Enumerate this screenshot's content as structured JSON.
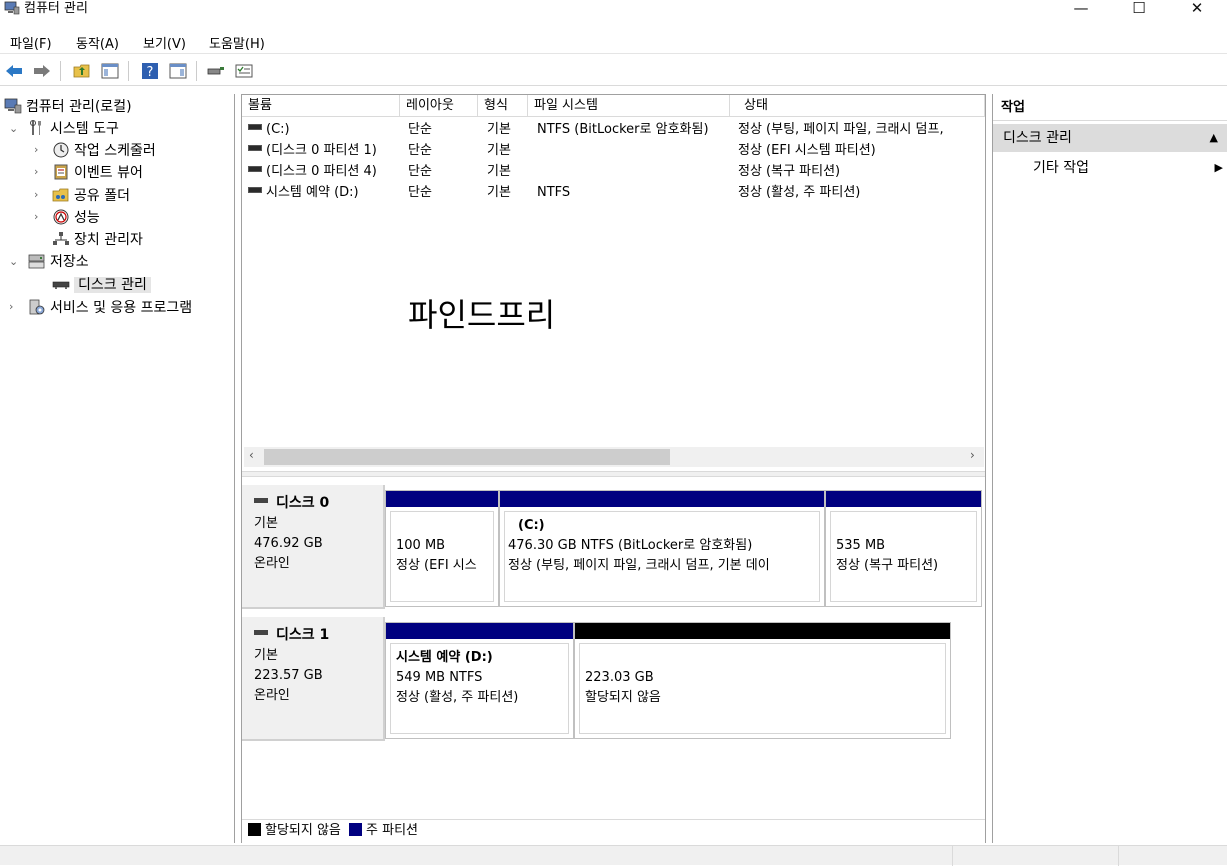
{
  "window": {
    "title": "컴퓨터 관리",
    "minimize": "—",
    "maximize": "☐",
    "close": "✕"
  },
  "menu": [
    "파일(F)",
    "동작(A)",
    "보기(V)",
    "도움말(H)"
  ],
  "tree": {
    "root": "컴퓨터 관리(로컬)",
    "system_tools": "시스템 도구",
    "task_scheduler": "작업 스케줄러",
    "event_viewer": "이벤트 뷰어",
    "shared_folders": "공유 폴더",
    "performance": "성능",
    "device_manager": "장치 관리자",
    "storage": "저장소",
    "disk_management": "디스크 관리",
    "services": "서비스 및 응용 프로그램"
  },
  "volume_list": {
    "columns": [
      "볼륨",
      "레이아웃",
      "형식",
      "파일 시스템",
      "상태"
    ],
    "rows": [
      {
        "volume": "(C:)",
        "layout": "단순",
        "type": "기본",
        "fs": "NTFS (BitLocker로 암호화됨)",
        "status": "정상 (부팅, 페이지 파일, 크래시 덤프,"
      },
      {
        "volume": "(디스크 0 파티션 1)",
        "layout": "단순",
        "type": "기본",
        "fs": "",
        "status": "정상 (EFI 시스템 파티션)"
      },
      {
        "volume": "(디스크 0 파티션 4)",
        "layout": "단순",
        "type": "기본",
        "fs": "",
        "status": "정상 (복구 파티션)"
      },
      {
        "volume": "시스템 예약 (D:)",
        "layout": "단순",
        "type": "기본",
        "fs": "NTFS",
        "status": "정상 (활성, 주 파티션)"
      }
    ]
  },
  "watermark": "파인드프리",
  "disks": [
    {
      "name": "디스크 0",
      "kind": "기본",
      "size": "476.92 GB",
      "state": "온라인",
      "partitions": [
        {
          "title": "",
          "line1": "100 MB",
          "line2": "정상 (EFI 시스"
        },
        {
          "title": "(C:)",
          "line1": "476.30 GB NTFS (BitLocker로 암호화됨)",
          "line2": "정상 (부팅, 페이지 파일, 크래시 덤프, 기본 데이"
        },
        {
          "title": "",
          "line1": "535 MB",
          "line2": "정상 (복구 파티션)"
        }
      ]
    },
    {
      "name": "디스크 1",
      "kind": "기본",
      "size": "223.57 GB",
      "state": "온라인",
      "partitions": [
        {
          "title": "시스템 예약  (D:)",
          "line1": "549 MB NTFS",
          "line2": "정상 (활성, 주 파티션)"
        },
        {
          "title": "",
          "line1": "223.03 GB",
          "line2": "할당되지 않음"
        }
      ]
    }
  ],
  "legend": {
    "unallocated": "할당되지 않음",
    "primary": "주 파티션"
  },
  "actions": {
    "header": "작업",
    "section": "디스크 관리",
    "more": "기타 작업"
  },
  "colors": {
    "primary_partition": "#000080",
    "unallocated": "#000000",
    "selection": "#e5e5e5"
  }
}
